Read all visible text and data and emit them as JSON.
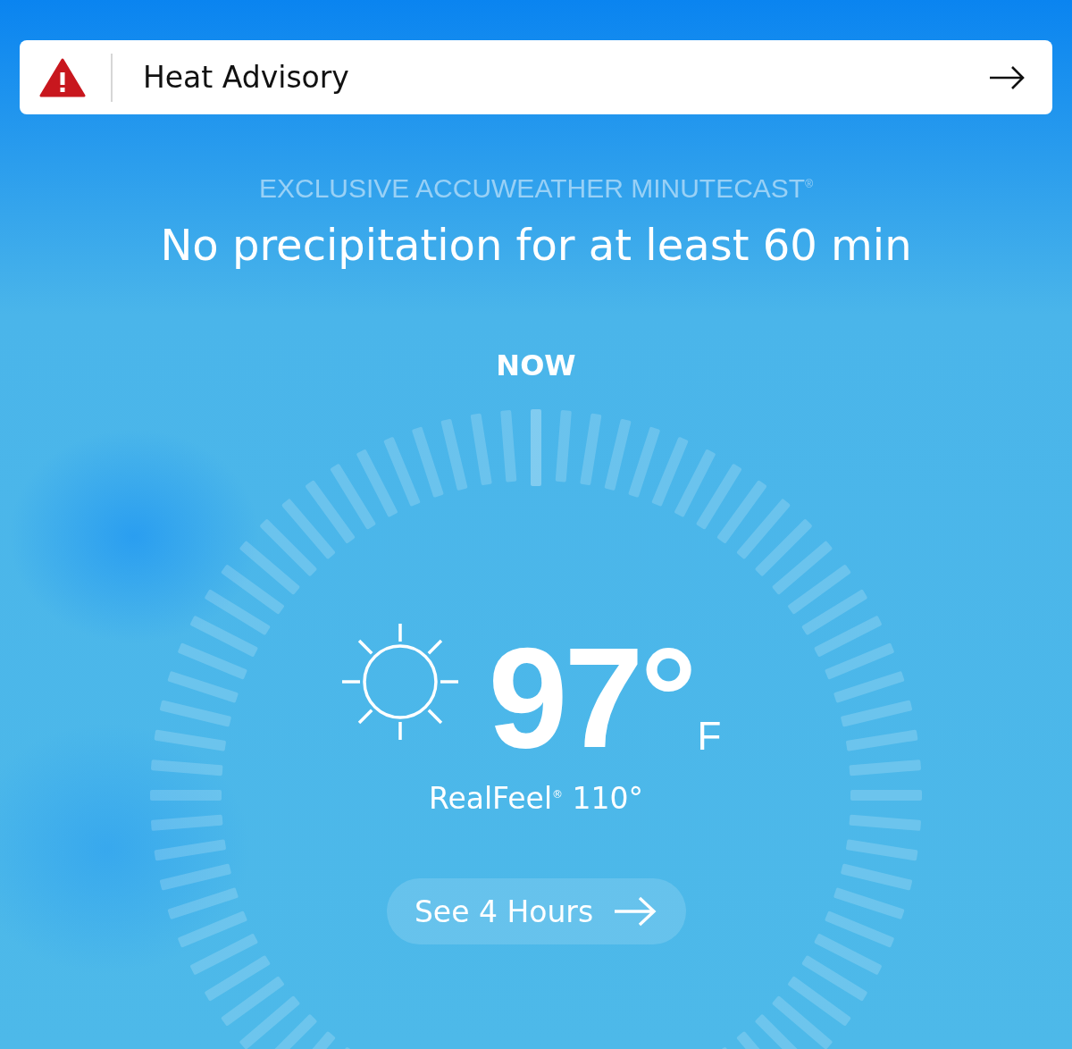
{
  "alert": {
    "title": "Heat Advisory"
  },
  "minutecast": {
    "label": "EXCLUSIVE ACCUWEATHER MINUTECAST$^{®}$",
    "summary": "No precipitation for at least 60 min",
    "now_label": "NOW"
  },
  "current": {
    "temperature": "97°",
    "unit": "F",
    "realfeel": "RealFeel$^{®}$ 110°"
  },
  "button": {
    "label": "See 4 Hours"
  }
}
